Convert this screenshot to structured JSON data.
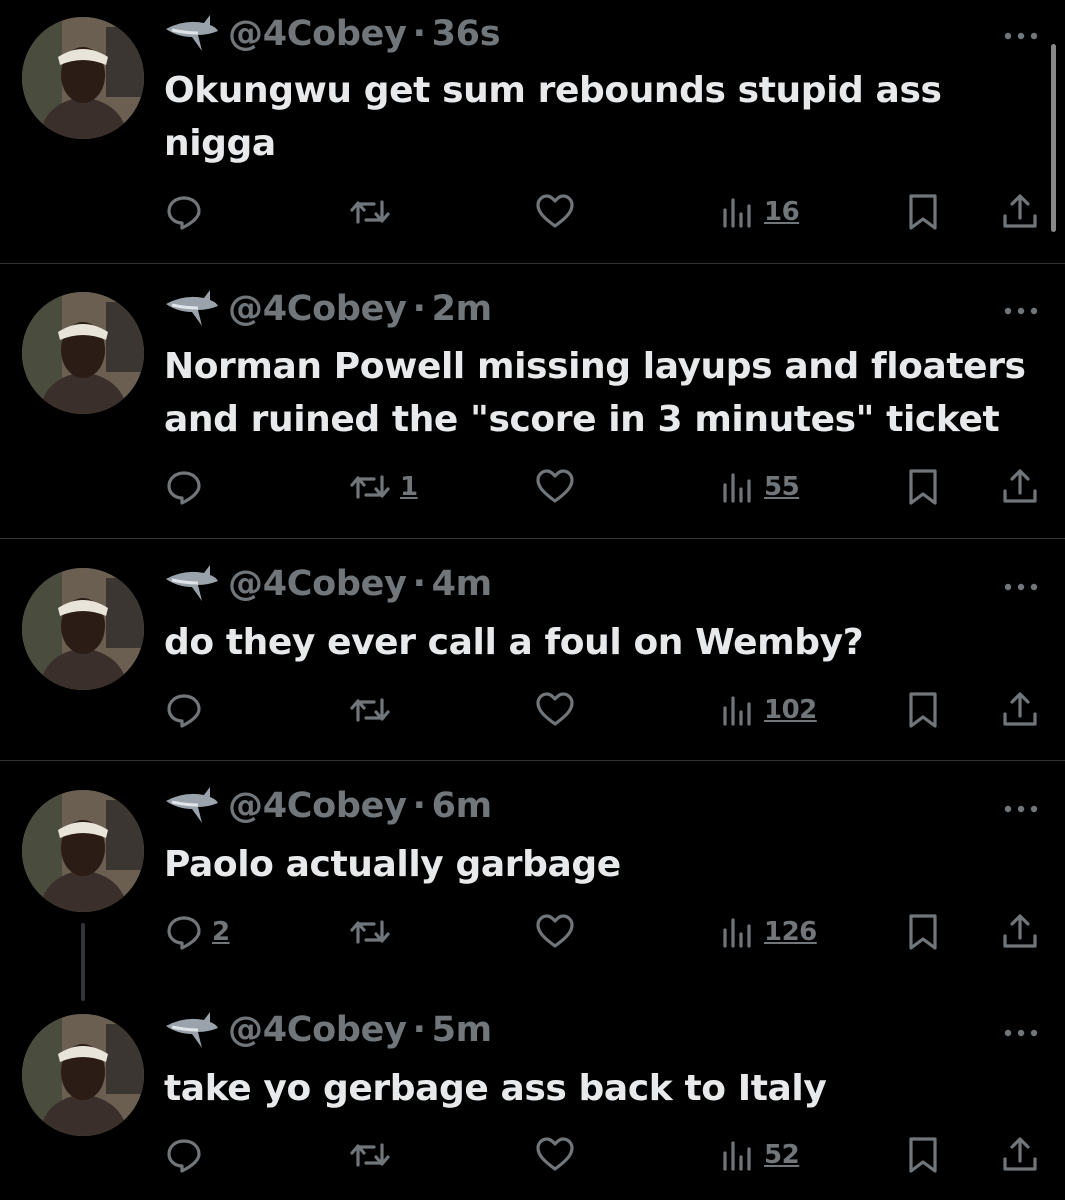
{
  "tweets": [
    {
      "handle": "@4Cobey",
      "time": "36s",
      "text": "Okungwu get sum rebounds stupid ass nigga",
      "replies": "",
      "retweets": "",
      "views": "16"
    },
    {
      "handle": "@4Cobey",
      "time": "2m",
      "text": "Norman Powell missing layups and floaters and ruined the \"score in 3 minutes\" ticket",
      "replies": "",
      "retweets": "1",
      "views": "55"
    },
    {
      "handle": "@4Cobey",
      "time": "4m",
      "text": "do they ever call a foul on Wemby?",
      "replies": "",
      "retweets": "",
      "views": "102"
    },
    {
      "handle": "@4Cobey",
      "time": "6m",
      "text": "Paolo actually garbage",
      "replies": "2",
      "retweets": "",
      "views": "126"
    },
    {
      "handle": "@4Cobey",
      "time": "5m",
      "text": "take yo gerbage ass back to Italy",
      "replies": "",
      "retweets": "",
      "views": "52"
    }
  ],
  "separator": "·",
  "icons": {
    "badge": "shark-icon",
    "more": "more-icon",
    "reply": "reply-icon",
    "retweet": "retweet-icon",
    "like": "like-icon",
    "views": "views-icon",
    "bookmark": "bookmark-icon",
    "share": "share-icon"
  },
  "colors": {
    "background": "#000000",
    "text": "#e7e9ea",
    "secondary": "#71767b",
    "divider": "#2f3336"
  }
}
